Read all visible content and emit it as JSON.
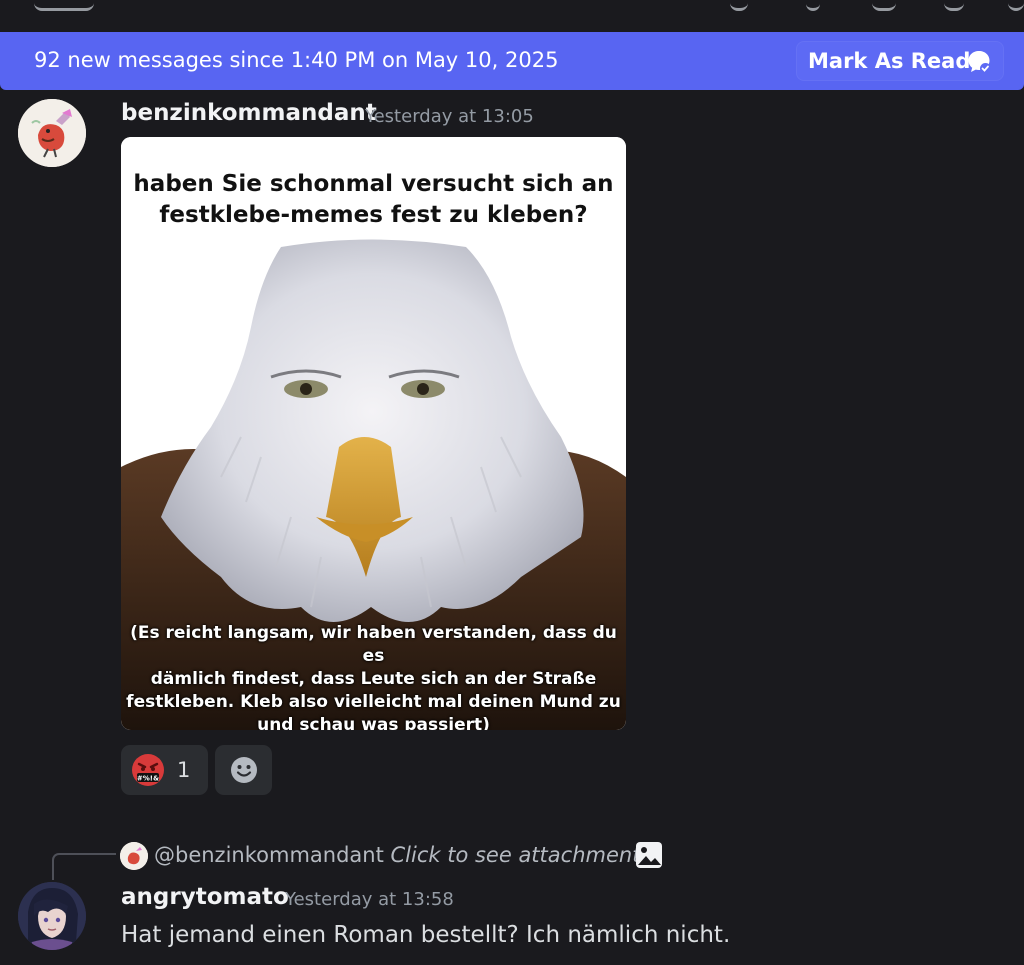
{
  "banner": {
    "text": "92 new messages since 1:40 PM on May 10, 2025",
    "mark_read_label": "Mark As Read"
  },
  "messages": [
    {
      "username": "benzinkommandant",
      "timestamp": "Yesterday at 13:05",
      "attachment": {
        "top_text": [
          "haben Sie schonmal versucht sich an",
          "festklebe-memes fest zu kleben?"
        ],
        "bottom_text": [
          "(Es reicht langsam, wir haben verstanden, dass du es",
          "dämlich findest, dass Leute sich an der Straße",
          "festkleben. Kleb also vielleicht mal deinen Mund zu",
          "und schau was passiert)"
        ]
      },
      "reactions": [
        {
          "emoji": "angry-cursing-face",
          "emoji_text": "#%!&",
          "count": "1"
        }
      ]
    },
    {
      "reply": {
        "mention": "@benzinkommandant",
        "preview": "Click to see attachment"
      },
      "username": "angrytomato",
      "timestamp": "Yesterday at 13:58",
      "text": "Hat jemand einen Roman bestellt? Ich nämlich nicht."
    }
  ],
  "colors": {
    "accent": "#5865f2",
    "background": "#1a1a1e"
  }
}
